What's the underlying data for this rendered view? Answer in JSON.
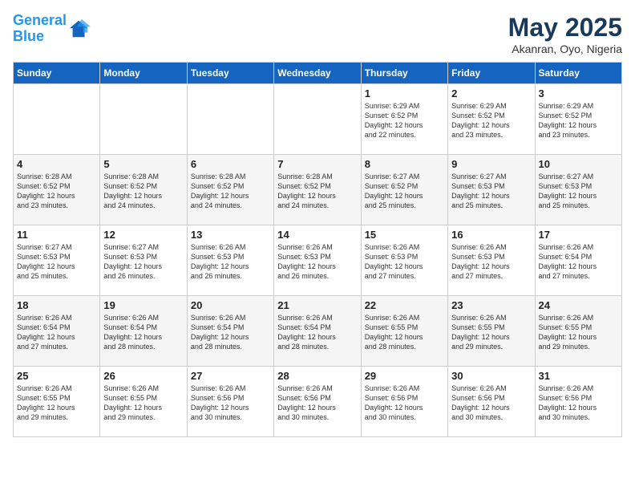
{
  "header": {
    "logo_line1": "General",
    "logo_line2": "Blue",
    "month": "May 2025",
    "location": "Akanran, Oyo, Nigeria"
  },
  "weekdays": [
    "Sunday",
    "Monday",
    "Tuesday",
    "Wednesday",
    "Thursday",
    "Friday",
    "Saturday"
  ],
  "weeks": [
    [
      {
        "day": "",
        "info": ""
      },
      {
        "day": "",
        "info": ""
      },
      {
        "day": "",
        "info": ""
      },
      {
        "day": "",
        "info": ""
      },
      {
        "day": "1",
        "info": "Sunrise: 6:29 AM\nSunset: 6:52 PM\nDaylight: 12 hours\nand 22 minutes."
      },
      {
        "day": "2",
        "info": "Sunrise: 6:29 AM\nSunset: 6:52 PM\nDaylight: 12 hours\nand 23 minutes."
      },
      {
        "day": "3",
        "info": "Sunrise: 6:29 AM\nSunset: 6:52 PM\nDaylight: 12 hours\nand 23 minutes."
      }
    ],
    [
      {
        "day": "4",
        "info": "Sunrise: 6:28 AM\nSunset: 6:52 PM\nDaylight: 12 hours\nand 23 minutes."
      },
      {
        "day": "5",
        "info": "Sunrise: 6:28 AM\nSunset: 6:52 PM\nDaylight: 12 hours\nand 24 minutes."
      },
      {
        "day": "6",
        "info": "Sunrise: 6:28 AM\nSunset: 6:52 PM\nDaylight: 12 hours\nand 24 minutes."
      },
      {
        "day": "7",
        "info": "Sunrise: 6:28 AM\nSunset: 6:52 PM\nDaylight: 12 hours\nand 24 minutes."
      },
      {
        "day": "8",
        "info": "Sunrise: 6:27 AM\nSunset: 6:52 PM\nDaylight: 12 hours\nand 25 minutes."
      },
      {
        "day": "9",
        "info": "Sunrise: 6:27 AM\nSunset: 6:53 PM\nDaylight: 12 hours\nand 25 minutes."
      },
      {
        "day": "10",
        "info": "Sunrise: 6:27 AM\nSunset: 6:53 PM\nDaylight: 12 hours\nand 25 minutes."
      }
    ],
    [
      {
        "day": "11",
        "info": "Sunrise: 6:27 AM\nSunset: 6:53 PM\nDaylight: 12 hours\nand 25 minutes."
      },
      {
        "day": "12",
        "info": "Sunrise: 6:27 AM\nSunset: 6:53 PM\nDaylight: 12 hours\nand 26 minutes."
      },
      {
        "day": "13",
        "info": "Sunrise: 6:26 AM\nSunset: 6:53 PM\nDaylight: 12 hours\nand 26 minutes."
      },
      {
        "day": "14",
        "info": "Sunrise: 6:26 AM\nSunset: 6:53 PM\nDaylight: 12 hours\nand 26 minutes."
      },
      {
        "day": "15",
        "info": "Sunrise: 6:26 AM\nSunset: 6:53 PM\nDaylight: 12 hours\nand 27 minutes."
      },
      {
        "day": "16",
        "info": "Sunrise: 6:26 AM\nSunset: 6:53 PM\nDaylight: 12 hours\nand 27 minutes."
      },
      {
        "day": "17",
        "info": "Sunrise: 6:26 AM\nSunset: 6:54 PM\nDaylight: 12 hours\nand 27 minutes."
      }
    ],
    [
      {
        "day": "18",
        "info": "Sunrise: 6:26 AM\nSunset: 6:54 PM\nDaylight: 12 hours\nand 27 minutes."
      },
      {
        "day": "19",
        "info": "Sunrise: 6:26 AM\nSunset: 6:54 PM\nDaylight: 12 hours\nand 28 minutes."
      },
      {
        "day": "20",
        "info": "Sunrise: 6:26 AM\nSunset: 6:54 PM\nDaylight: 12 hours\nand 28 minutes."
      },
      {
        "day": "21",
        "info": "Sunrise: 6:26 AM\nSunset: 6:54 PM\nDaylight: 12 hours\nand 28 minutes."
      },
      {
        "day": "22",
        "info": "Sunrise: 6:26 AM\nSunset: 6:55 PM\nDaylight: 12 hours\nand 28 minutes."
      },
      {
        "day": "23",
        "info": "Sunrise: 6:26 AM\nSunset: 6:55 PM\nDaylight: 12 hours\nand 29 minutes."
      },
      {
        "day": "24",
        "info": "Sunrise: 6:26 AM\nSunset: 6:55 PM\nDaylight: 12 hours\nand 29 minutes."
      }
    ],
    [
      {
        "day": "25",
        "info": "Sunrise: 6:26 AM\nSunset: 6:55 PM\nDaylight: 12 hours\nand 29 minutes."
      },
      {
        "day": "26",
        "info": "Sunrise: 6:26 AM\nSunset: 6:55 PM\nDaylight: 12 hours\nand 29 minutes."
      },
      {
        "day": "27",
        "info": "Sunrise: 6:26 AM\nSunset: 6:56 PM\nDaylight: 12 hours\nand 30 minutes."
      },
      {
        "day": "28",
        "info": "Sunrise: 6:26 AM\nSunset: 6:56 PM\nDaylight: 12 hours\nand 30 minutes."
      },
      {
        "day": "29",
        "info": "Sunrise: 6:26 AM\nSunset: 6:56 PM\nDaylight: 12 hours\nand 30 minutes."
      },
      {
        "day": "30",
        "info": "Sunrise: 6:26 AM\nSunset: 6:56 PM\nDaylight: 12 hours\nand 30 minutes."
      },
      {
        "day": "31",
        "info": "Sunrise: 6:26 AM\nSunset: 6:56 PM\nDaylight: 12 hours\nand 30 minutes."
      }
    ]
  ]
}
